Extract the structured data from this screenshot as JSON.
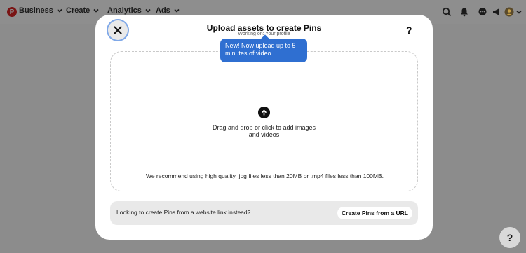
{
  "nav": {
    "logo_letter": "P",
    "business_label": "Business",
    "create_label": "Create",
    "analytics_label": "Analytics",
    "ads_label": "Ads"
  },
  "modal": {
    "title": "Upload assets to create Pins",
    "subtitle": "Working on: Your profile",
    "help_label": "?",
    "tooltip": "New! Now upload up to 5 minutes of video",
    "drop_text": "Drag and drop or click to add images and videos",
    "recommendation": "We recommend using high quality .jpg files less than 20MB or .mp4 files less than 100MB.",
    "url_prompt": "Looking to create Pins from a website link instead?",
    "url_button": "Create Pins from a URL"
  },
  "help_fab_label": "?",
  "colors": {
    "overlay": "#8c8c8c",
    "tooltip": "#2f6fd1",
    "focus_ring": "#7fa8e8",
    "modal_bg": "#ffffff"
  }
}
